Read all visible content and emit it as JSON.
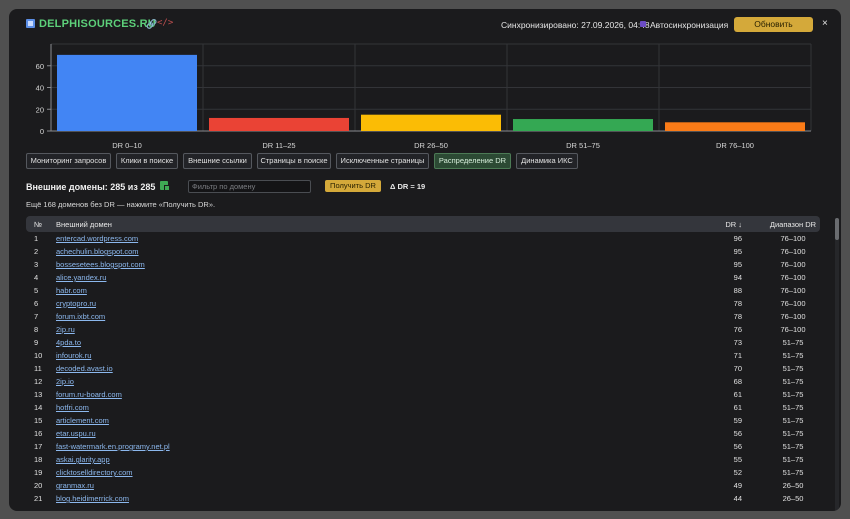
{
  "header": {
    "site_name": "DELPHISOURCES.RU",
    "link_icon": "link-icon",
    "code_icon": "code-icon",
    "sync_text": "Синхронизировано: 27.09.2026, 04:48",
    "auto_sync_label": "Автосинхронизация",
    "refresh_label": "Обновить",
    "close_label": "×"
  },
  "chart_data": {
    "type": "bar",
    "categories": [
      "DR 0–10",
      "DR 11–25",
      "DR 26–50",
      "DR 51–75",
      "DR 76–100"
    ],
    "values": [
      70,
      12,
      15,
      11,
      8
    ],
    "colors": [
      "#4285f4",
      "#ea4335",
      "#fbbc05",
      "#34a853",
      "#fa7b17"
    ],
    "yticks": [
      0,
      20,
      40,
      60
    ],
    "ylim": [
      0,
      80
    ],
    "grid": true
  },
  "tabs": [
    {
      "label": "Мониторинг запросов",
      "active": false
    },
    {
      "label": "Клики в поиске",
      "active": false
    },
    {
      "label": "Внешние ссылки",
      "active": false
    },
    {
      "label": "Страницы в поиске",
      "active": false
    },
    {
      "label": "Исключенные страницы",
      "active": false
    },
    {
      "label": "Распределение DR",
      "active": true
    },
    {
      "label": "Динамика ИКС",
      "active": false
    }
  ],
  "domains": {
    "title": "Внешние домены: 285 из 285",
    "filter_placeholder": "Фильтр по домену",
    "get_dr_label": "Получить DR",
    "delta_label": "Δ DR = 19",
    "note": "Ещё 168 доменов без DR — нажмите «Получить DR»."
  },
  "table": {
    "columns": {
      "num": "№",
      "domain": "Внешний домен",
      "dr": "DR ↓",
      "range": "Диапазон DR"
    },
    "rows": [
      {
        "num": "1",
        "domain": "entercad.wordpress.com",
        "dr": "96",
        "range": "76–100"
      },
      {
        "num": "2",
        "domain": "achechulin.blogspot.com",
        "dr": "95",
        "range": "76–100"
      },
      {
        "num": "3",
        "domain": "bossesetees.blogspot.com",
        "dr": "95",
        "range": "76–100"
      },
      {
        "num": "4",
        "domain": "alice.yandex.ru",
        "dr": "94",
        "range": "76–100"
      },
      {
        "num": "5",
        "domain": "habr.com",
        "dr": "88",
        "range": "76–100"
      },
      {
        "num": "6",
        "domain": "cryptopro.ru",
        "dr": "78",
        "range": "76–100"
      },
      {
        "num": "7",
        "domain": "forum.ixbt.com",
        "dr": "78",
        "range": "76–100"
      },
      {
        "num": "8",
        "domain": "2ip.ru",
        "dr": "76",
        "range": "76–100"
      },
      {
        "num": "9",
        "domain": "4pda.to",
        "dr": "73",
        "range": "51–75"
      },
      {
        "num": "10",
        "domain": "infourok.ru",
        "dr": "71",
        "range": "51–75"
      },
      {
        "num": "11",
        "domain": "decoded.avast.io",
        "dr": "70",
        "range": "51–75"
      },
      {
        "num": "12",
        "domain": "2ip.io",
        "dr": "68",
        "range": "51–75"
      },
      {
        "num": "13",
        "domain": "forum.ru-board.com",
        "dr": "61",
        "range": "51–75"
      },
      {
        "num": "14",
        "domain": "hotfri.com",
        "dr": "61",
        "range": "51–75"
      },
      {
        "num": "15",
        "domain": "articlement.com",
        "dr": "59",
        "range": "51–75"
      },
      {
        "num": "16",
        "domain": "etar.uspu.ru",
        "dr": "56",
        "range": "51–75"
      },
      {
        "num": "17",
        "domain": "fast-watermark.en.programy.net.pl",
        "dr": "56",
        "range": "51–75"
      },
      {
        "num": "18",
        "domain": "askai.glarity.app",
        "dr": "55",
        "range": "51–75"
      },
      {
        "num": "19",
        "domain": "clicktoselldirectory.com",
        "dr": "52",
        "range": "51–75"
      },
      {
        "num": "20",
        "domain": "granmax.ru",
        "dr": "49",
        "range": "26–50"
      },
      {
        "num": "21",
        "domain": "blog.heidimerrick.com",
        "dr": "44",
        "range": "26–50"
      }
    ]
  }
}
